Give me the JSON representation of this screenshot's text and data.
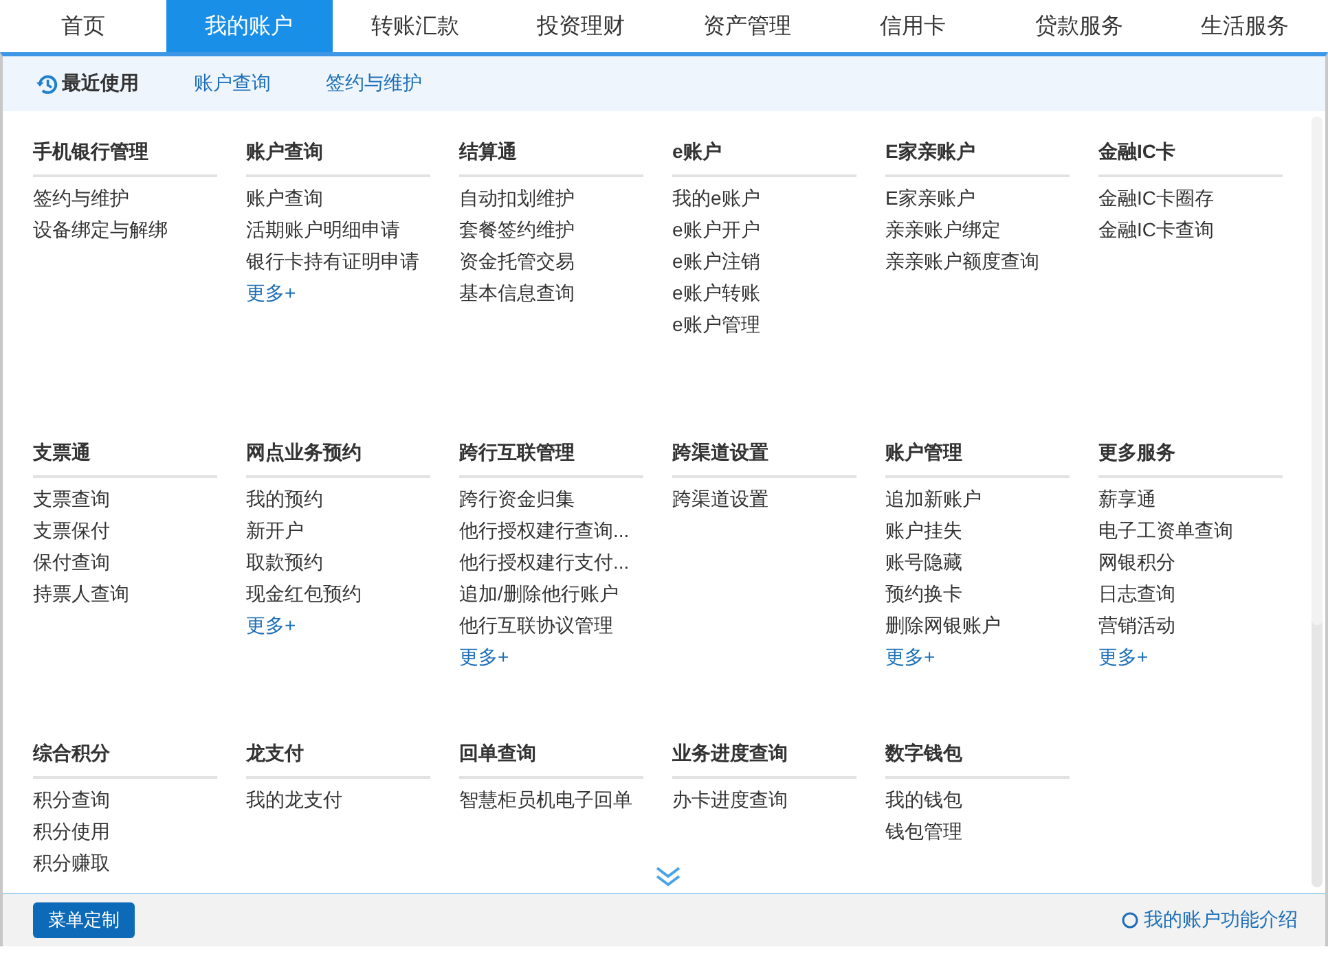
{
  "tabs": [
    {
      "label": "首页",
      "selected": false
    },
    {
      "label": "我的账户",
      "selected": true
    },
    {
      "label": "转账汇款",
      "selected": false
    },
    {
      "label": "投资理财",
      "selected": false
    },
    {
      "label": "资产管理",
      "selected": false
    },
    {
      "label": "信用卡",
      "selected": false
    },
    {
      "label": "贷款服务",
      "selected": false
    },
    {
      "label": "生活服务",
      "selected": false
    }
  ],
  "quick_bar": [
    {
      "kind": "recent",
      "label": "最近使用"
    },
    {
      "kind": "link",
      "label": "账户查询"
    },
    {
      "kind": "link",
      "label": "签约与维护"
    }
  ],
  "menu_groups": [
    {
      "title": "手机银行管理",
      "items": [
        "签约与维护",
        "设备绑定与解绑"
      ]
    },
    {
      "title": "账户查询",
      "items": [
        "账户查询",
        "活期账户明细申请",
        "银行卡持有证明申请"
      ],
      "more": "更多+"
    },
    {
      "title": "结算通",
      "items": [
        "自动扣划维护",
        "套餐签约维护",
        "资金托管交易",
        "基本信息查询"
      ]
    },
    {
      "title": "e账户",
      "items": [
        "我的e账户",
        "e账户开户",
        "e账户注销",
        "e账户转账",
        "e账户管理"
      ]
    },
    {
      "title": "E家亲账户",
      "items": [
        "E家亲账户",
        "亲亲账户绑定",
        "亲亲账户额度查询"
      ]
    },
    {
      "title": "金融IC卡",
      "items": [
        "金融IC卡圈存",
        "金融IC卡查询"
      ]
    },
    {
      "title": "支票通",
      "items": [
        "支票查询",
        "支票保付",
        "保付查询",
        "持票人查询"
      ]
    },
    {
      "title": "网点业务预约",
      "items": [
        "我的预约",
        "新开户",
        "取款预约",
        "现金红包预约"
      ],
      "more": "更多+"
    },
    {
      "title": "跨行互联管理",
      "items": [
        "跨行资金归集",
        "他行授权建行查询...",
        "他行授权建行支付...",
        "追加/删除他行账户",
        "他行互联协议管理"
      ],
      "more": "更多+"
    },
    {
      "title": "跨渠道设置",
      "items": [
        "跨渠道设置"
      ]
    },
    {
      "title": "账户管理",
      "items": [
        "追加新账户",
        "账户挂失",
        "账号隐藏",
        "预约换卡",
        "删除网银账户"
      ],
      "more": "更多+"
    },
    {
      "title": "更多服务",
      "items": [
        "薪享通",
        "电子工资单查询",
        "网银积分",
        "日志查询",
        "营销活动"
      ],
      "more": "更多+"
    },
    {
      "title": "综合积分",
      "items": [
        "积分查询",
        "积分使用",
        "积分赚取"
      ]
    },
    {
      "title": "龙支付",
      "items": [
        "我的龙支付"
      ]
    },
    {
      "title": "回单查询",
      "items": [
        "智慧柜员机电子回单"
      ]
    },
    {
      "title": "业务进度查询",
      "items": [
        "办卡进度查询"
      ]
    },
    {
      "title": "数字钱包",
      "items": [
        "我的钱包",
        "钱包管理"
      ]
    }
  ],
  "footer": {
    "button": "菜单定制",
    "intro_link": "我的账户功能介绍"
  }
}
